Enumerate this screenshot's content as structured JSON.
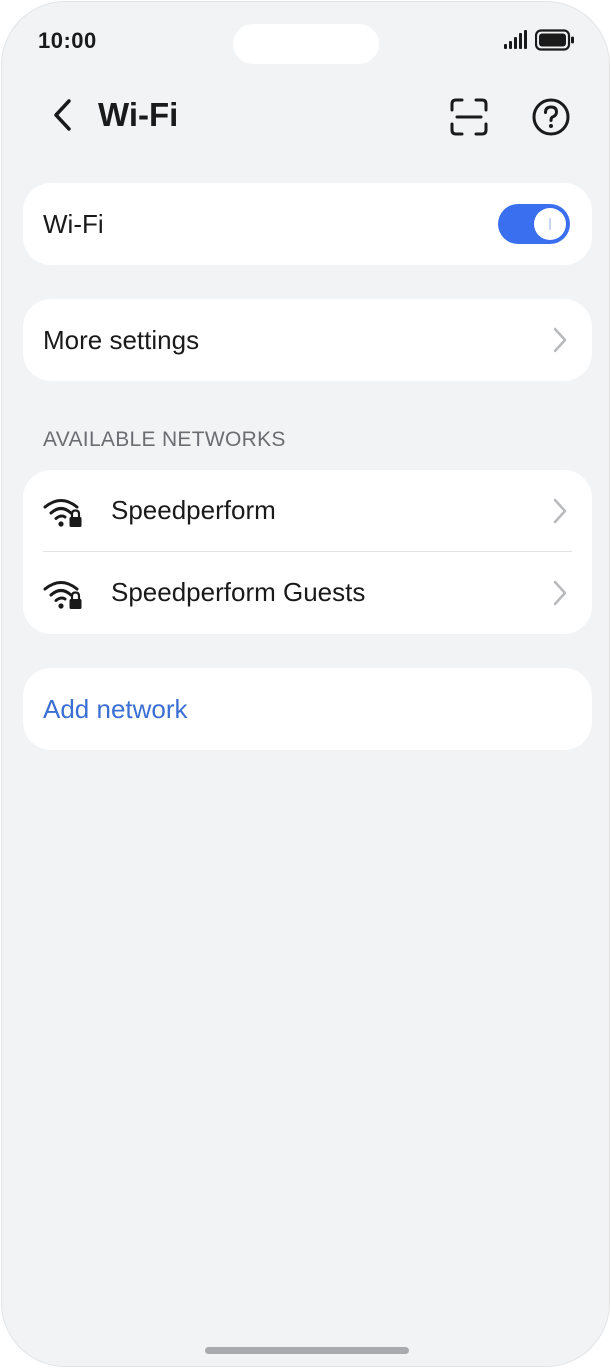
{
  "status_bar": {
    "time": "10:00",
    "signal_icon": "signal-bars-icon",
    "battery_icon": "battery-full-icon"
  },
  "header": {
    "title": "Wi-Fi",
    "back_icon": "chevron-left-icon",
    "scan_icon": "scan-icon",
    "help_icon": "help-circle-icon"
  },
  "wifi_toggle": {
    "label": "Wi-Fi",
    "enabled": true,
    "accent_color": "#3a6ff0"
  },
  "more_settings": {
    "label": "More settings"
  },
  "available_networks": {
    "header": "AVAILABLE NETWORKS",
    "networks": [
      {
        "name": "Speedperform",
        "icon": "wifi-locked-icon"
      },
      {
        "name": "Speedperform Guests",
        "icon": "wifi-locked-icon"
      }
    ]
  },
  "add_network": {
    "label": "Add network",
    "color": "#3b6fd4"
  }
}
